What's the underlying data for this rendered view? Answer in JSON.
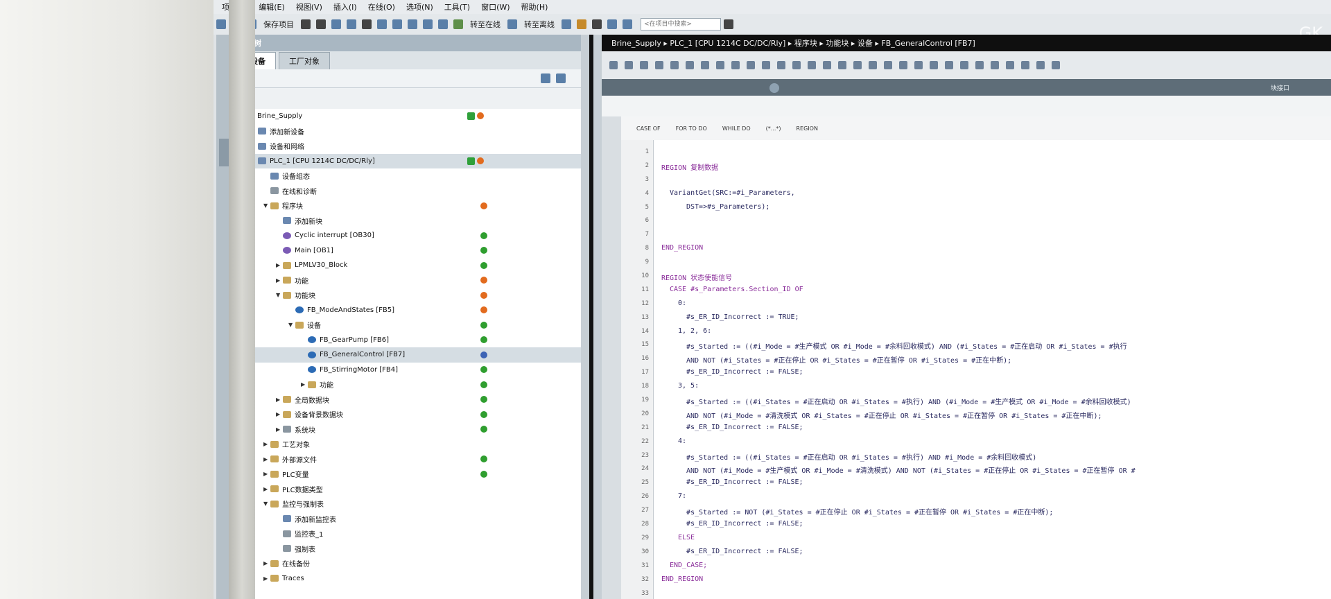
{
  "menu": [
    "项目(P)",
    "编辑(E)",
    "视图(V)",
    "插入(I)",
    "在线(O)",
    "选项(N)",
    "工具(T)",
    "窗口(W)",
    "帮助(H)"
  ],
  "toolbar": {
    "save_label": "保存项目",
    "go_online": "转至在线",
    "go_offline": "转至离线",
    "search_placeholder": "<在项目中搜索>"
  },
  "watermark": "GK",
  "tree": {
    "header": "项目树",
    "tabs": [
      "设备",
      "工厂对象"
    ],
    "items": [
      {
        "label": "Brine_Supply",
        "indent": 0,
        "arrow": "▼",
        "icon": "gen",
        "status": [
          "check",
          "orange"
        ]
      },
      {
        "label": "添加新设备",
        "indent": 1,
        "arrow": "",
        "icon": "device",
        "status": []
      },
      {
        "label": "设备和网络",
        "indent": 1,
        "arrow": "",
        "icon": "device",
        "status": []
      },
      {
        "label": "PLC_1 [CPU 1214C DC/DC/Rly]",
        "indent": 1,
        "arrow": "▼",
        "icon": "device",
        "status": [
          "check",
          "orange"
        ],
        "selected": true
      },
      {
        "label": "设备组态",
        "indent": 2,
        "arrow": "",
        "icon": "device",
        "status": []
      },
      {
        "label": "在线和诊断",
        "indent": 2,
        "arrow": "",
        "icon": "gen",
        "status": []
      },
      {
        "label": "程序块",
        "indent": 2,
        "arrow": "▼",
        "icon": "folder",
        "status": [
          "orange"
        ]
      },
      {
        "label": "添加新块",
        "indent": 3,
        "arrow": "",
        "icon": "device",
        "status": []
      },
      {
        "label": "Cyclic interrupt [OB30]",
        "indent": 3,
        "arrow": "",
        "icon": "block",
        "status": [
          "green"
        ]
      },
      {
        "label": "Main [OB1]",
        "indent": 3,
        "arrow": "",
        "icon": "block",
        "status": [
          "green"
        ]
      },
      {
        "label": "LPMLV30_Block",
        "indent": 3,
        "arrow": "▶",
        "icon": "folder",
        "status": [
          "green"
        ]
      },
      {
        "label": "功能",
        "indent": 3,
        "arrow": "▶",
        "icon": "folder",
        "status": [
          "orange"
        ]
      },
      {
        "label": "功能块",
        "indent": 3,
        "arrow": "▼",
        "icon": "folder",
        "status": [
          "orange"
        ]
      },
      {
        "label": "FB_ModeAndStates [FB5]",
        "indent": 4,
        "arrow": "",
        "icon": "fb",
        "status": [
          "orange"
        ]
      },
      {
        "label": "设备",
        "indent": 4,
        "arrow": "▼",
        "icon": "folder",
        "status": [
          "green"
        ]
      },
      {
        "label": "FB_GearPump [FB6]",
        "indent": 5,
        "arrow": "",
        "icon": "fb",
        "status": [
          "green"
        ]
      },
      {
        "label": "FB_GeneralControl [FB7]",
        "indent": 5,
        "arrow": "",
        "icon": "fb",
        "status": [
          "blue"
        ],
        "selected": true
      },
      {
        "label": "FB_StirringMotor [FB4]",
        "indent": 5,
        "arrow": "",
        "icon": "fb",
        "status": [
          "green"
        ]
      },
      {
        "label": "功能",
        "indent": 5,
        "arrow": "▶",
        "icon": "folder",
        "status": [
          "green"
        ]
      },
      {
        "label": "全局数据块",
        "indent": 3,
        "arrow": "▶",
        "icon": "folder",
        "status": [
          "green"
        ]
      },
      {
        "label": "设备背景数据块",
        "indent": 3,
        "arrow": "▶",
        "icon": "folder",
        "status": [
          "green"
        ]
      },
      {
        "label": "系统块",
        "indent": 3,
        "arrow": "▶",
        "icon": "gen",
        "status": [
          "green"
        ]
      },
      {
        "label": "工艺对象",
        "indent": 2,
        "arrow": "▶",
        "icon": "folder",
        "status": []
      },
      {
        "label": "外部源文件",
        "indent": 2,
        "arrow": "▶",
        "icon": "folder",
        "status": [
          "green"
        ]
      },
      {
        "label": "PLC变量",
        "indent": 2,
        "arrow": "▶",
        "icon": "folder",
        "status": [
          "green"
        ]
      },
      {
        "label": "PLC数据类型",
        "indent": 2,
        "arrow": "▶",
        "icon": "folder",
        "status": []
      },
      {
        "label": "监控与强制表",
        "indent": 2,
        "arrow": "▼",
        "icon": "folder",
        "status": []
      },
      {
        "label": "添加新监控表",
        "indent": 3,
        "arrow": "",
        "icon": "device",
        "status": []
      },
      {
        "label": "监控表_1",
        "indent": 3,
        "arrow": "",
        "icon": "gen",
        "status": []
      },
      {
        "label": "强制表",
        "indent": 3,
        "arrow": "",
        "icon": "gen",
        "status": []
      },
      {
        "label": "在线备份",
        "indent": 2,
        "arrow": "▶",
        "icon": "folder",
        "status": []
      },
      {
        "label": "Traces",
        "indent": 2,
        "arrow": "▶",
        "icon": "folder",
        "status": []
      }
    ]
  },
  "breadcrumb": "Brine_Supply ▸ PLC_1 [CPU 1214C DC/DC/Rly] ▸ 程序块 ▸ 功能块 ▸ 设备 ▸ FB_GeneralControl [FB7]",
  "editor": {
    "strip_label": "块接口",
    "header_items": [
      "CASE OF",
      "FOR TO DO",
      "WHILE DO",
      "(*...*)",
      "REGION"
    ],
    "lines": [
      {
        "n": "1",
        "indent": 0,
        "code": ""
      },
      {
        "n": "2",
        "indent": 0,
        "code": "REGION 复制数据",
        "kw": true
      },
      {
        "n": "3",
        "indent": 0,
        "code": ""
      },
      {
        "n": "4",
        "indent": 2,
        "code": "VariantGet(SRC:=#i_Parameters,"
      },
      {
        "n": "5",
        "indent": 6,
        "code": "DST=>#s_Parameters);"
      },
      {
        "n": "6",
        "indent": 0,
        "code": ""
      },
      {
        "n": "7",
        "indent": 0,
        "code": ""
      },
      {
        "n": "8",
        "indent": 0,
        "code": "END_REGION",
        "kw": true
      },
      {
        "n": "9",
        "indent": 0,
        "code": ""
      },
      {
        "n": "10",
        "indent": 0,
        "code": "REGION 状态使能信号",
        "kw": true
      },
      {
        "n": "11",
        "indent": 2,
        "code": "CASE #s_Parameters.Section_ID OF",
        "kw": true
      },
      {
        "n": "12",
        "indent": 4,
        "code": "0:"
      },
      {
        "n": "13",
        "indent": 6,
        "code": "#s_ER_ID_Incorrect := TRUE;"
      },
      {
        "n": "14",
        "indent": 4,
        "code": "1, 2, 6:"
      },
      {
        "n": "15",
        "indent": 6,
        "code": "#s_Started := ((#i_Mode = #生产模式 OR #i_Mode = #余料回收模式) AND (#i_States = #正在启动 OR #i_States = #执行"
      },
      {
        "n": "16",
        "indent": 6,
        "code": "AND NOT (#i_States = #正在停止 OR #i_States = #正在暂停 OR #i_States = #正在中断);"
      },
      {
        "n": "17",
        "indent": 6,
        "code": "#s_ER_ID_Incorrect := FALSE;"
      },
      {
        "n": "18",
        "indent": 4,
        "code": "3, 5:"
      },
      {
        "n": "19",
        "indent": 6,
        "code": "#s_Started := ((#i_States = #正在启动 OR #i_States = #执行) AND (#i_Mode = #生产模式 OR #i_Mode = #余料回收模式)"
      },
      {
        "n": "20",
        "indent": 6,
        "code": "AND NOT (#i_Mode = #清洗模式 OR #i_States = #正在停止 OR #i_States = #正在暂停 OR #i_States = #正在中断);"
      },
      {
        "n": "21",
        "indent": 6,
        "code": "#s_ER_ID_Incorrect := FALSE;"
      },
      {
        "n": "22",
        "indent": 4,
        "code": "4:"
      },
      {
        "n": "23",
        "indent": 6,
        "code": "#s_Started := ((#i_States = #正在启动 OR #i_States = #执行) AND #i_Mode = #余料回收模式)"
      },
      {
        "n": "24",
        "indent": 6,
        "code": "AND NOT (#i_Mode = #生产模式 OR #i_Mode = #清洗模式) AND NOT (#i_States = #正在停止 OR #i_States = #正在暂停 OR #"
      },
      {
        "n": "25",
        "indent": 6,
        "code": "#s_ER_ID_Incorrect := FALSE;"
      },
      {
        "n": "26",
        "indent": 4,
        "code": "7:"
      },
      {
        "n": "27",
        "indent": 6,
        "code": "#s_Started := NOT (#i_States = #正在停止 OR #i_States = #正在暂停 OR #i_States = #正在中断);"
      },
      {
        "n": "28",
        "indent": 6,
        "code": "#s_ER_ID_Incorrect := FALSE;"
      },
      {
        "n": "29",
        "indent": 4,
        "code": "ELSE",
        "kw": true
      },
      {
        "n": "30",
        "indent": 6,
        "code": "#s_ER_ID_Incorrect := FALSE;"
      },
      {
        "n": "31",
        "indent": 2,
        "code": "END_CASE;",
        "kw": true
      },
      {
        "n": "32",
        "indent": 0,
        "code": "END_REGION",
        "kw": true
      },
      {
        "n": "33",
        "indent": 0,
        "code": ""
      }
    ]
  }
}
